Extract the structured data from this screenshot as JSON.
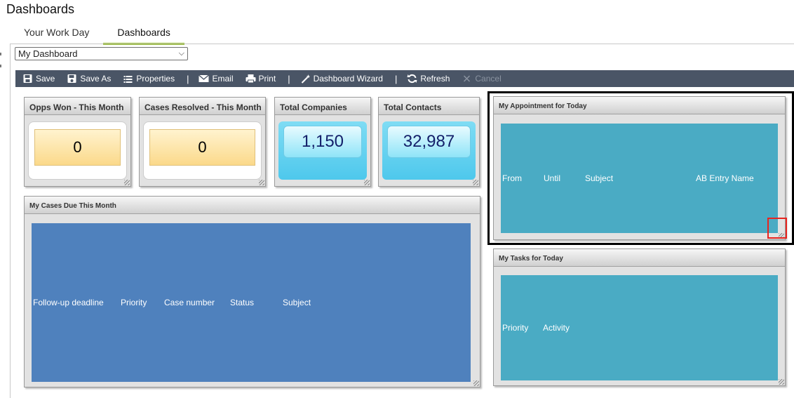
{
  "page": {
    "title": "Dashboards"
  },
  "tabs": [
    {
      "label": "Your Work Day"
    },
    {
      "label": "Dashboards",
      "active": true
    }
  ],
  "dashboard_select": {
    "value": "My Dashboard"
  },
  "toolbar": {
    "save": "Save",
    "save_as": "Save As",
    "properties": "Properties",
    "email": "Email",
    "print": "Print",
    "wizard": "Dashboard Wizard",
    "refresh": "Refresh",
    "cancel": "Cancel",
    "separator": "|"
  },
  "widgets": {
    "opps_won": {
      "title": "Opps Won - This Month",
      "value": "0"
    },
    "cases_resolved": {
      "title": "Cases Resolved - This Month",
      "value": "0"
    },
    "total_companies": {
      "title": "Total Companies",
      "value": "1,150"
    },
    "total_contacts": {
      "title": "Total Contacts",
      "value": "32,987"
    },
    "appointments": {
      "title": "My Appointment for Today",
      "columns": [
        "From",
        "Until",
        "Subject",
        "AB Entry Name"
      ],
      "color": "#4aabc4"
    },
    "cases_due": {
      "title": "My Cases Due This Month",
      "columns": [
        "Follow-up deadline",
        "Priority",
        "Case number",
        "Status",
        "Subject"
      ],
      "color": "#4f81bd"
    },
    "tasks": {
      "title": "My Tasks for Today",
      "columns": [
        "Priority",
        "Activity"
      ],
      "color": "#4aabc4"
    }
  },
  "colors": {
    "toolbar": "#4a5566",
    "tab_accent": "#8fba1e",
    "highlight": "#000000",
    "marker": "#e8241f"
  }
}
